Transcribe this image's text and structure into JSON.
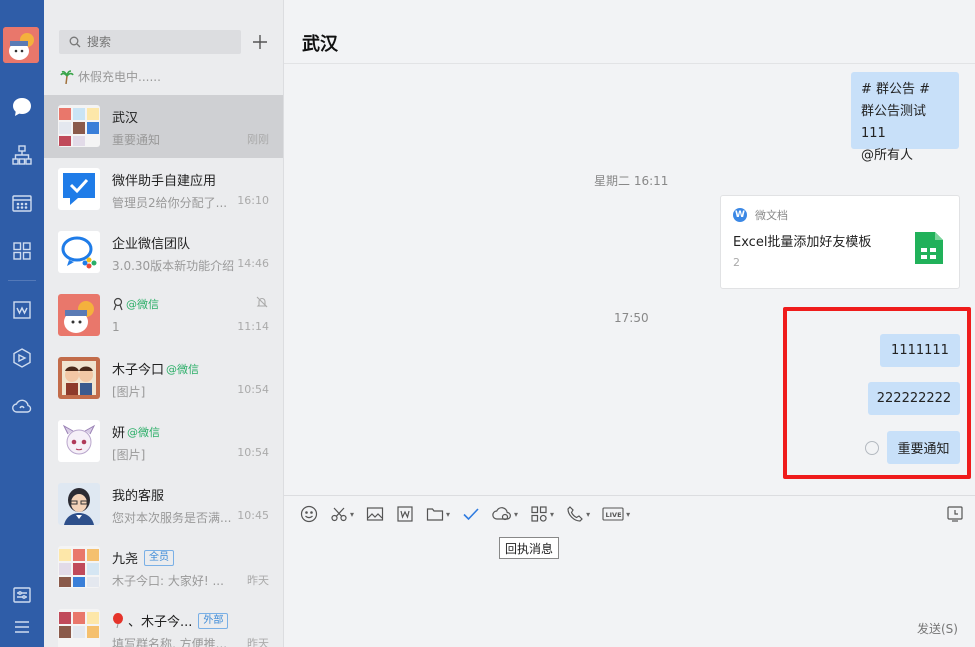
{
  "sidebar_rail": {
    "items": [
      {
        "name": "message-icon"
      },
      {
        "name": "contacts-icon"
      },
      {
        "name": "calendar-icon"
      },
      {
        "name": "workbench-icon"
      },
      {
        "name": "docs-icon"
      },
      {
        "name": "drive-icon"
      },
      {
        "name": "cloud-icon"
      },
      {
        "name": "settings-icon"
      },
      {
        "name": "menu-icon"
      }
    ]
  },
  "list": {
    "search_placeholder": "搜索",
    "status": "休假充电中......",
    "conversations": [
      {
        "name": "武汉",
        "preview": "重要通知",
        "time": "刚刚",
        "active": true
      },
      {
        "name": "微伴助手自建应用",
        "preview": "管理员2给你分配了...",
        "time": "16:10"
      },
      {
        "name": "企业微信团队",
        "preview": "3.0.30版本新功能介绍",
        "time": "14:46"
      },
      {
        "name": "",
        "wx": "@微信",
        "preview": "1",
        "time": "11:14",
        "muted": true
      },
      {
        "name": "木子今口",
        "wx": "@微信",
        "preview": "[图片]",
        "time": "10:54"
      },
      {
        "name": "妍",
        "wx": "@微信",
        "preview": "[图片]",
        "time": "10:54"
      },
      {
        "name": "我的客服",
        "preview": "您对本次服务是否满...",
        "time": "10:45"
      },
      {
        "name": "九尧",
        "tag": "全员",
        "preview": "木子今口: 大家好! ...",
        "time": "昨天"
      },
      {
        "name": "、木子今...",
        "tag": "外部",
        "preview": "填写群名称, 方便推...",
        "time": "昨天"
      }
    ]
  },
  "chat": {
    "title": "武汉",
    "notice_lines": [
      "# 群公告 #",
      "群公告测试111",
      "@所有人"
    ],
    "timestamp1": "星期二 16:11",
    "doc_card": {
      "source": "微文档",
      "title": "Excel批量添加好友模板",
      "count": "2"
    },
    "timestamp2": "17:50",
    "messages": [
      "1111111",
      "222222222",
      "重要通知"
    ],
    "tooltip": "回执消息",
    "send_label": "发送(S)"
  },
  "colors": {
    "rail": "#2f5da8",
    "bubble": "#c8e0f9",
    "highlight": "#ef1b1b",
    "wechat_green": "#2aae67",
    "accent": "#3b88e5"
  }
}
